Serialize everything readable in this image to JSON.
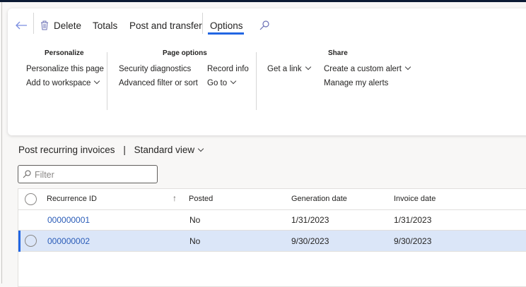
{
  "toolbar": {
    "delete": "Delete",
    "totals": "Totals",
    "post_transfer": "Post and transfer",
    "options": "Options"
  },
  "ribbon": {
    "personalize": {
      "title": "Personalize",
      "items": [
        "Personalize this page",
        "Add to workspace"
      ]
    },
    "page_options": {
      "title": "Page options",
      "items": [
        "Security diagnostics",
        "Advanced filter or sort",
        "Record info",
        "Go to"
      ]
    },
    "share": {
      "title": "Share",
      "items": [
        "Get a link",
        "Create a custom alert",
        "Manage my alerts"
      ]
    }
  },
  "page": {
    "title": "Post recurring invoices",
    "separator": "|",
    "view": "Standard view"
  },
  "filter": {
    "placeholder": "Filter"
  },
  "grid": {
    "columns": [
      "Recurrence ID",
      "Posted",
      "Generation date",
      "Invoice date"
    ],
    "rows": [
      {
        "id": "000000001",
        "posted": "No",
        "gen": "1/31/2023",
        "inv": "1/31/2023"
      },
      {
        "id": "000000002",
        "posted": "No",
        "gen": "9/30/2023",
        "inv": "9/30/2023"
      }
    ]
  },
  "colors": {
    "accent": "#2266e3",
    "selected": "#dbe6f8",
    "link": "#2a5cb8"
  }
}
